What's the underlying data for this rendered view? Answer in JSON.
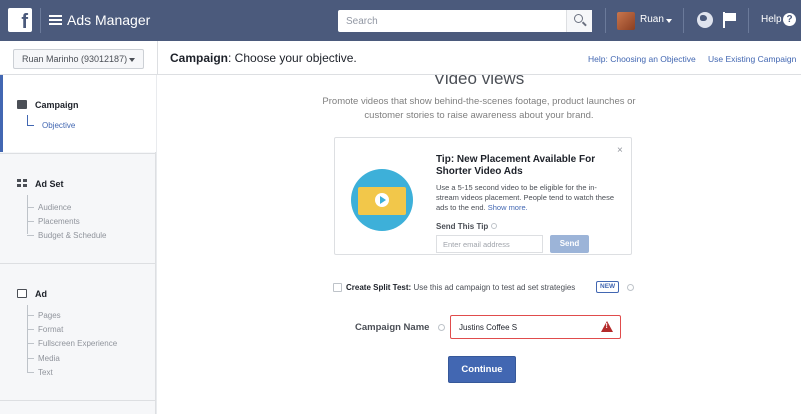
{
  "topbar": {
    "logo": "f",
    "app_title": "Ads Manager",
    "search_placeholder": "Search",
    "user_name": "Ruan",
    "help_label": "Help",
    "help_icon_glyph": "?",
    "bg_color": "#4b5a7c"
  },
  "subbar": {
    "account": "Ruan Marinho (93012187)",
    "title_bold": "Campaign",
    "title_rest": ": Choose your objective.",
    "help_link": "Help: Choosing an Objective",
    "use_existing_link": "Use Existing Campaign"
  },
  "sidebar": {
    "campaign": {
      "label": "Campaign",
      "items": [
        "Objective"
      ]
    },
    "adset": {
      "label": "Ad Set",
      "items": [
        "Audience",
        "Placements",
        "Budget & Schedule"
      ]
    },
    "ad": {
      "label": "Ad",
      "items": [
        "Pages",
        "Format",
        "Fullscreen Experience",
        "Media",
        "Text"
      ]
    }
  },
  "main": {
    "objective_heading": "Video views",
    "objective_desc": "Promote videos that show behind-the-scenes footage, product launches or customer stories to raise awareness about your brand.",
    "tip": {
      "close": "×",
      "title": "Tip: New Placement Available For Shorter Video Ads",
      "body": "Use a 5-15 second video to be eligible for the in-stream videos placement. People tend to watch these ads to the end.",
      "show_more": "Show more.",
      "send_label": "Send This Tip",
      "email_placeholder": "Enter email address",
      "send_button": "Send"
    },
    "split_test": {
      "label": "Create Split Test:",
      "text": "Use this ad campaign to test ad set strategies",
      "badge": "NEW"
    },
    "campaign_name": {
      "label": "Campaign Name",
      "value": "Justins Coffee S"
    },
    "continue_button": "Continue",
    "accent_color": "#4267b2",
    "error_color": "#e04c4c"
  }
}
